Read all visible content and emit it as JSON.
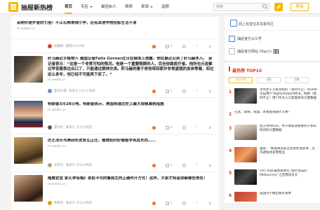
{
  "header": {
    "brand": "抽屉新热榜",
    "nav": [
      {
        "label": "首页",
        "active": true,
        "dropdown": false
      },
      {
        "label": "专区",
        "active": false,
        "dropdown": true
      },
      {
        "label": "最佳Bi人",
        "active": false,
        "dropdown": false
      },
      {
        "label": "视频",
        "active": false,
        "dropdown": false
      },
      {
        "label": "发现",
        "active": false,
        "dropdown": true
      },
      {
        "label": "话题",
        "active": false,
        "dropdown": false
      }
    ],
    "search_placeholder": "搜索",
    "login_label": "登录"
  },
  "feed": [
    {
      "title": "采购价是外省的七倍！不止石棉青银小学，还有其他学校招标生活不清",
      "source": "m.weibo.cn",
      "author": "",
      "time": "",
      "hot": "",
      "likes": "",
      "comments": "",
      "stars": "",
      "shares": ""
    },
    {
      "title": "",
      "source": "m.weibo.cn",
      "author": "闻鹿晚",
      "time": "刚刚(14)小时",
      "hot": "",
      "likes": "1",
      "comments": "",
      "stars": "",
      "shares": ""
    },
    {
      "title": "肝马赫近手植物人 德国记者Felix Gorner近日在媒体上透露，他在最近见到了肝马赫本人。 该记者表示：“这是一个非常可怕的情况。他是一个重要照顾的人，完全依赖医疗者。他所也元说都过早答案表达出口了，只能通过眼神交流。肝马赫的妻子将他带回家并非常虚弱的身体等健，却过这么多年，他已经不可能再下床了。”",
      "source": "m.weibo.cn",
      "author": "夏天叶晨",
      "time": "发布于 (11)小时前",
      "hot": "",
      "likes": "1",
      "comments": "",
      "stars": "",
      "shares": ""
    },
    {
      "title": "特朗普3月28日电，特朗普表示，美国将通过史上最大规模减税措施",
      "source": "m.weibo.cn",
      "author": "夏天叶",
      "time": "发布于 (11)小时前",
      "hot": "",
      "likes": "1",
      "comments": "",
      "stars": "",
      "shares": ""
    },
    {
      "title": "厉艺冰乐与黑研所发表互正比，看她如何好像能学到其东西……",
      "source": "m.weibo.cn",
      "author": "天宇长",
      "time": "发布于 (11)小时前",
      "hot": "",
      "likes": "1",
      "comments": "",
      "stars": "",
      "shares": ""
    },
    {
      "title": "隆威官宣 家孔孝吸烟》首批卡司的警局生的正确时开方式！这样，大家才知道我都哪些角色！",
      "source": "m.weibo.cn",
      "author": "陈明华",
      "time": "发布于 (11)小时前",
      "hot": "",
      "likes": "1",
      "comments": "",
      "stars": "",
      "shares": ""
    }
  ],
  "sidebar": {
    "banner_text": "网上有害信息举报专区",
    "links": [
      {
        "label": "抽屉官方公众号",
        "icon": "wechat-icon"
      },
      {
        "label": "抽屉官方网站 (Top小)",
        "icon": "qr-icon"
      }
    ],
    "hot": {
      "title": "最热榜 TOP10",
      "tabs": [
        "24小时",
        "3天",
        "1周"
      ],
      "active_tab": "24小时",
      "items": [
        {
          "rank": "1",
          "title": "英伟达十万张架构的（现时不止）Reddit 论坛用户 NightsRobertWild，他将（现时不止）用户作为人工智能体的大量数据"
        },
        {
          "rank": "2",
          "title": "在此，雷明，家国…甚者越来越什么要？"
        },
        {
          "rank": "3",
          "title": "西方领导的天，终于明知道要服务于家长时间的大量数据"
        },
        {
          "rank": "4",
          "title": "国家：“加强食品安全监管标准变革，无可避免并有零售业"
        },
        {
          "rank": "5",
          "title": "OPT-4o的最新版本在“图片生成的Midjourney“之后我该太大"
        },
        {
          "rank": "6",
          "title": "美国对于推出服务基本"
        }
      ]
    }
  },
  "colors": {
    "accent": "#f5b800",
    "hot_red": "#e03a1e"
  }
}
